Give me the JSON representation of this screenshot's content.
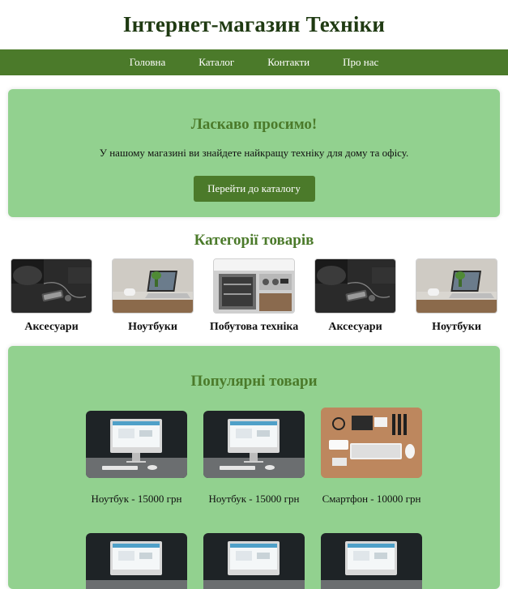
{
  "header": {
    "title": "Інтернет-магазин Техніки"
  },
  "nav": {
    "items": [
      {
        "label": "Головна"
      },
      {
        "label": "Каталог"
      },
      {
        "label": "Контакти"
      },
      {
        "label": "Про нас"
      }
    ]
  },
  "welcome": {
    "heading": "Ласкаво просимо!",
    "text": "У нашому магазині ви знайдете найкращу техніку для дому та офісу.",
    "button_label": "Перейти до каталогу"
  },
  "categories": {
    "heading": "Категорії товарів",
    "items": [
      {
        "label": "Аксесуари",
        "image": "accessories-photo"
      },
      {
        "label": "Ноутбуки",
        "image": "laptop-photo"
      },
      {
        "label": "Побутова техніка",
        "image": "oven-photo"
      },
      {
        "label": "Аксесуари",
        "image": "accessories-photo"
      },
      {
        "label": "Ноутбуки",
        "image": "laptop-photo"
      }
    ]
  },
  "popular": {
    "heading": "Популярні товари",
    "products": [
      {
        "name": "Ноутбук - 15000 грн",
        "image": "imac-photo"
      },
      {
        "name": "Ноутбук - 15000 грн",
        "image": "imac-photo"
      },
      {
        "name": "Смартфон - 10000 грн",
        "image": "desk-flatlay-photo"
      },
      {
        "name": "",
        "image": "imac-photo"
      },
      {
        "name": "",
        "image": "imac-photo"
      },
      {
        "name": "",
        "image": "imac-photo"
      }
    ]
  },
  "colors": {
    "nav_bg": "#4b7a2a",
    "panel_bg": "#92d18f",
    "heading_green": "#4b7a2a",
    "title_dark": "#1f3a12"
  }
}
